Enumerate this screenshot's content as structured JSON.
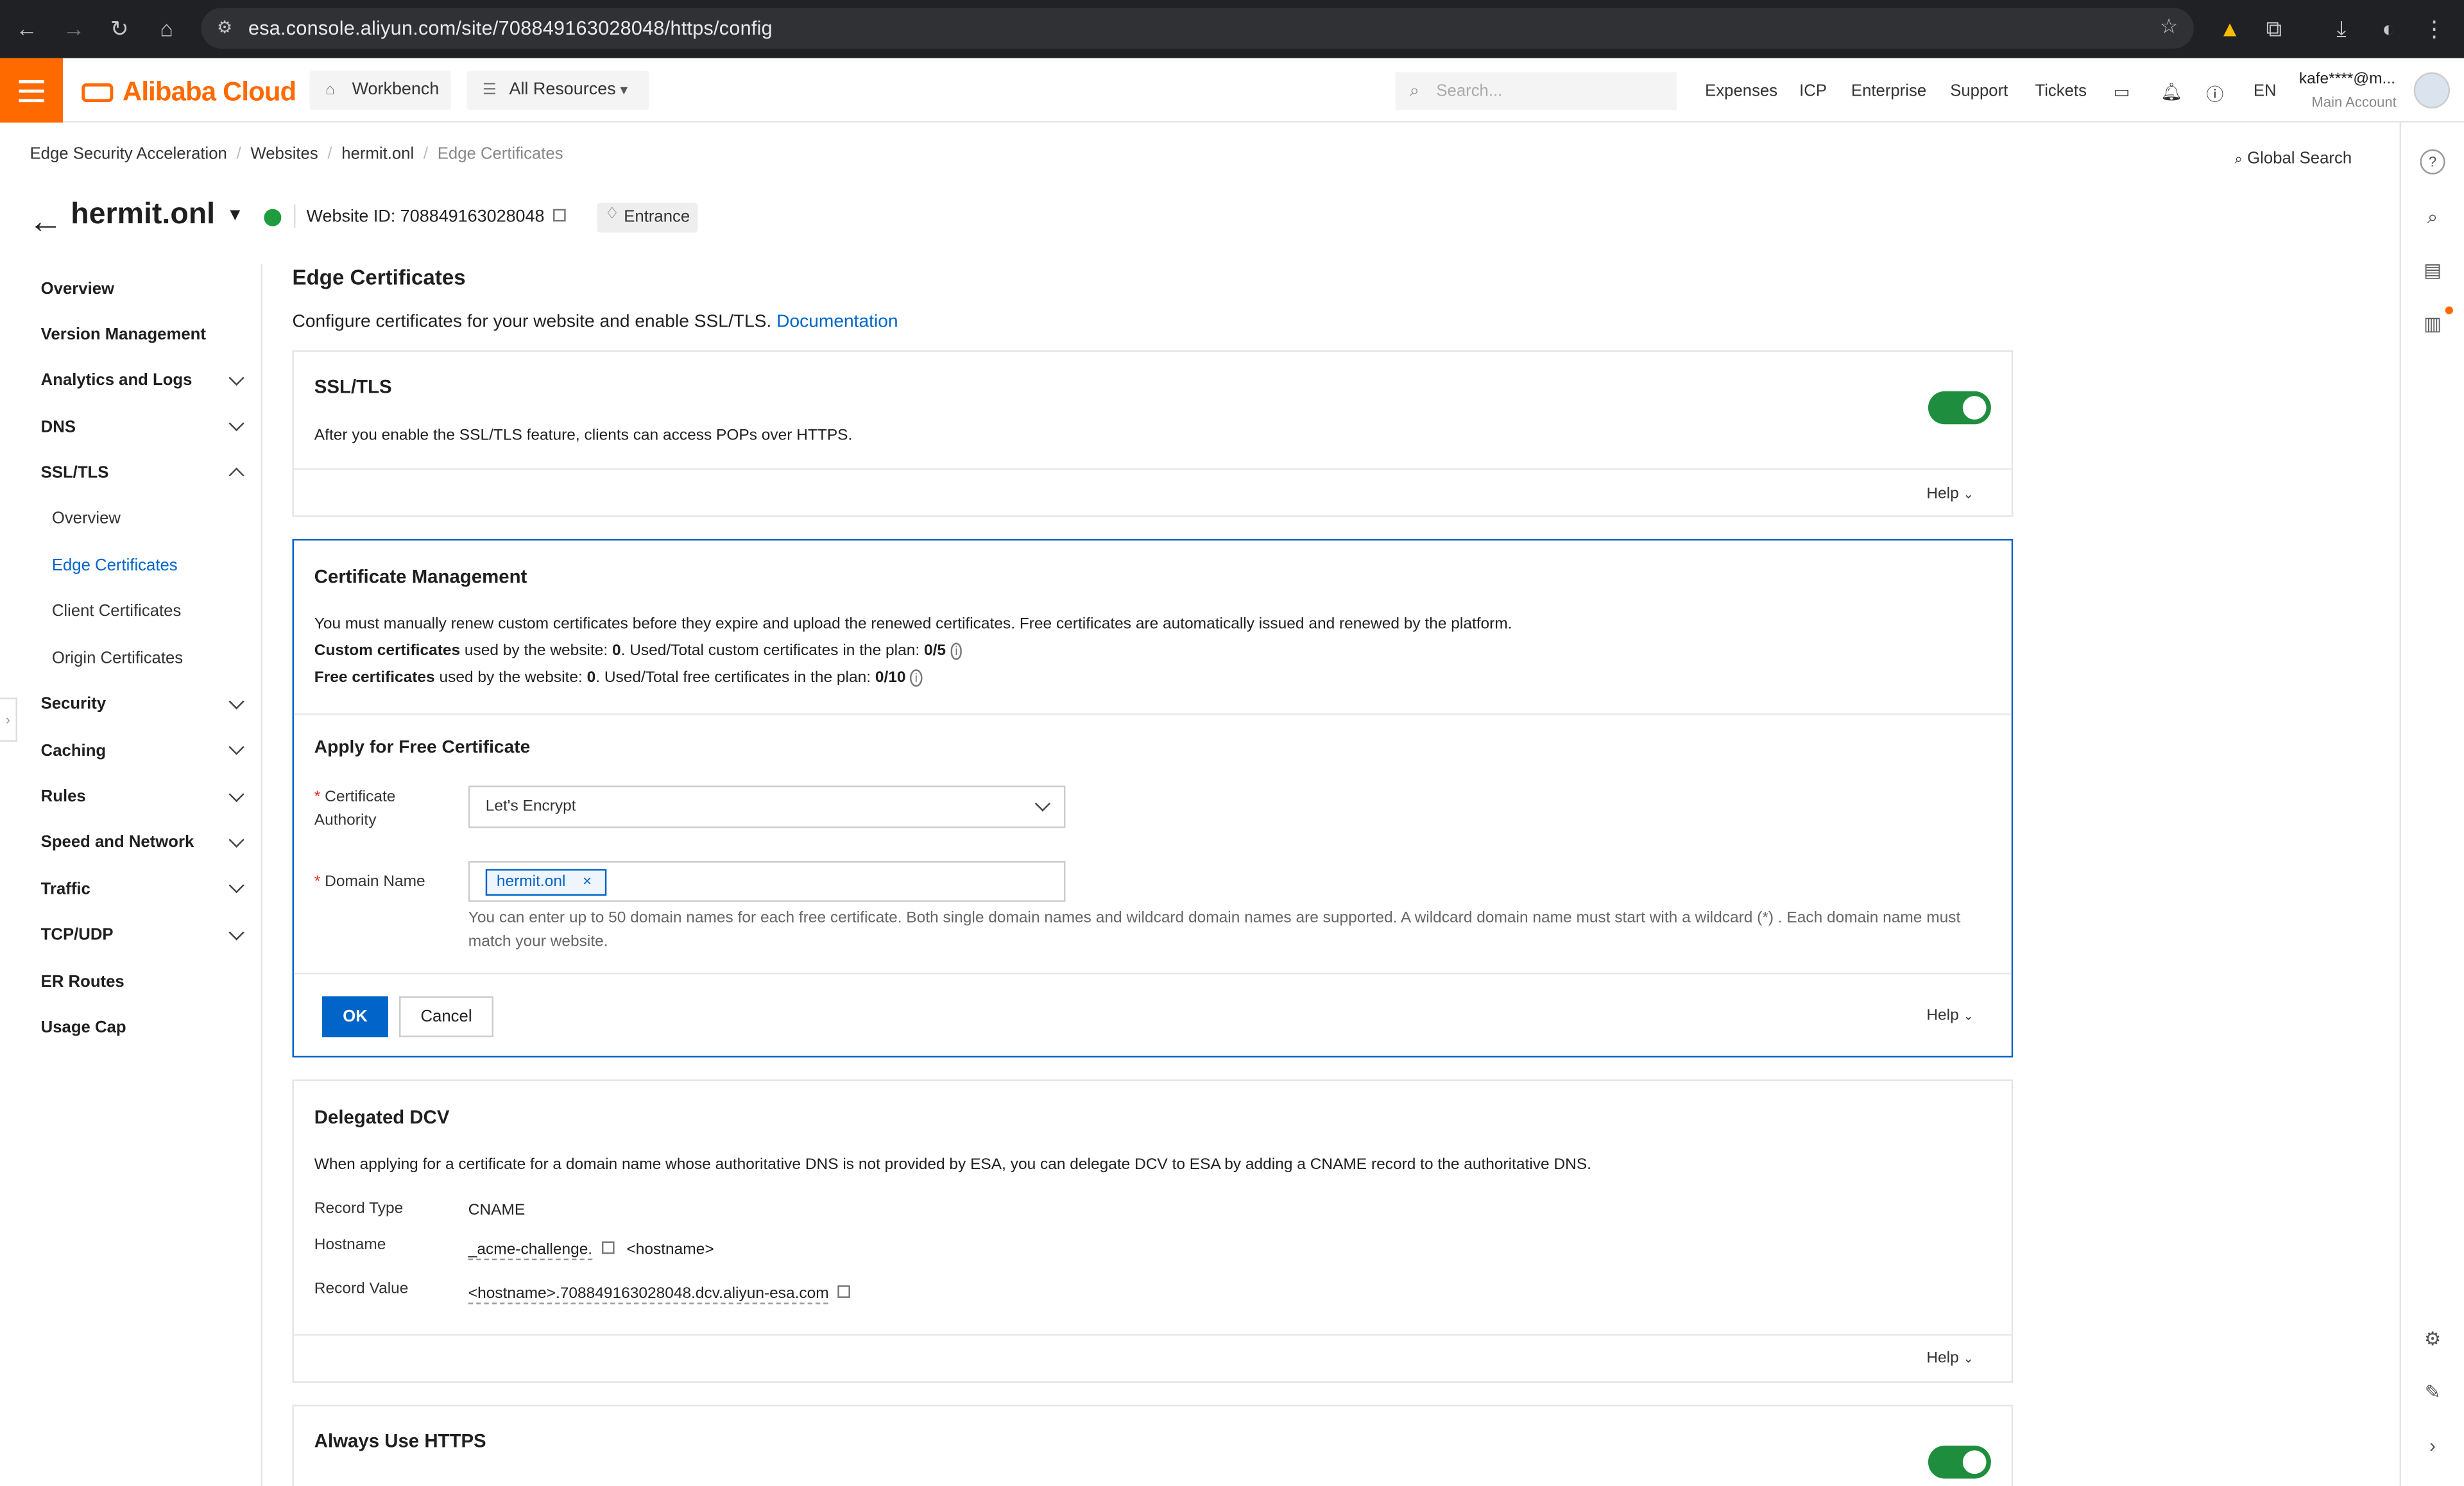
{
  "browser": {
    "url": "esa.console.aliyun.com/site/708849163028048/https/config"
  },
  "topnav": {
    "logo": "Alibaba Cloud",
    "workbench": "Workbench",
    "all_resources": "All Resources",
    "search_placeholder": "Search...",
    "links": [
      "Expenses",
      "ICP",
      "Enterprise",
      "Support",
      "Tickets"
    ],
    "lang": "EN",
    "account_name": "kafe****@m...",
    "account_type": "Main Account"
  },
  "breadcrumb": [
    "Edge Security Acceleration",
    "Websites",
    "hermit.onl",
    "Edge Certificates"
  ],
  "global_search": "Global Search",
  "header": {
    "site": "hermit.onl",
    "website_id": "Website ID: 708849163028048",
    "entrance": "Entrance"
  },
  "sidebar": {
    "items": [
      "Overview",
      "Version Management",
      "Analytics and Logs",
      "DNS",
      "SSL/TLS"
    ],
    "ssl_sub": [
      "Overview",
      "Edge Certificates",
      "Client Certificates",
      "Origin Certificates"
    ],
    "items2": [
      "Security",
      "Caching",
      "Rules",
      "Speed and Network",
      "Traffic",
      "TCP/UDP",
      "ER Routes",
      "Usage Cap"
    ]
  },
  "main": {
    "title": "Edge Certificates",
    "desc": "Configure certificates for your website and enable SSL/TLS.",
    "doc_link": "Documentation",
    "help": "Help",
    "ssl": {
      "title": "SSL/TLS",
      "text": "After you enable the SSL/TLS feature, clients can access POPs over HTTPS.",
      "enabled": true
    },
    "cert_mgmt": {
      "title": "Certificate Management",
      "line1": "You must manually renew custom certificates before they expire and upload the renewed certificates. Free certificates are automatically issued and renewed by the platform.",
      "custom_label": "Custom certificates",
      "custom_mid": " used by the website: ",
      "custom_count": "0",
      "custom_mid2": ". Used/Total custom certificates in the plan: ",
      "custom_total": "0/5",
      "free_label": "Free certificates",
      "free_mid": " used by the website: ",
      "free_count": "0",
      "free_mid2": ". Used/Total free certificates in the plan: ",
      "free_total": "0/10",
      "apply_title": "Apply for Free Certificate",
      "ca_label": "Certificate Authority",
      "ca_value": "Let's Encrypt",
      "domain_label": "Domain Name",
      "domain_tag": "hermit.onl",
      "hint": "You can enter up to 50 domain names for each free certificate. Both single domain names and wildcard domain names are supported. A wildcard domain name must start with a wildcard (*) . Each domain name must match your website.",
      "ok": "OK",
      "cancel": "Cancel"
    },
    "dcv": {
      "title": "Delegated DCV",
      "text": "When applying for a certificate for a domain name whose authoritative DNS is not provided by ESA, you can delegate DCV to ESA by adding a CNAME record to the authoritative DNS.",
      "record_type_k": "Record Type",
      "record_type_v": "CNAME",
      "hostname_k": "Hostname",
      "hostname_v": "_acme-challenge.",
      "hostname_suffix": "<hostname>",
      "value_k": "Record Value",
      "value_v": "<hostname>.708849163028048.dcv.aliyun-esa.com"
    },
    "always_https": {
      "title": "Always Use HTTPS",
      "enabled": true
    }
  },
  "colors": {
    "brand": "#ff6a00",
    "link": "#0064c8",
    "toggle_on": "#1e8e3e"
  }
}
